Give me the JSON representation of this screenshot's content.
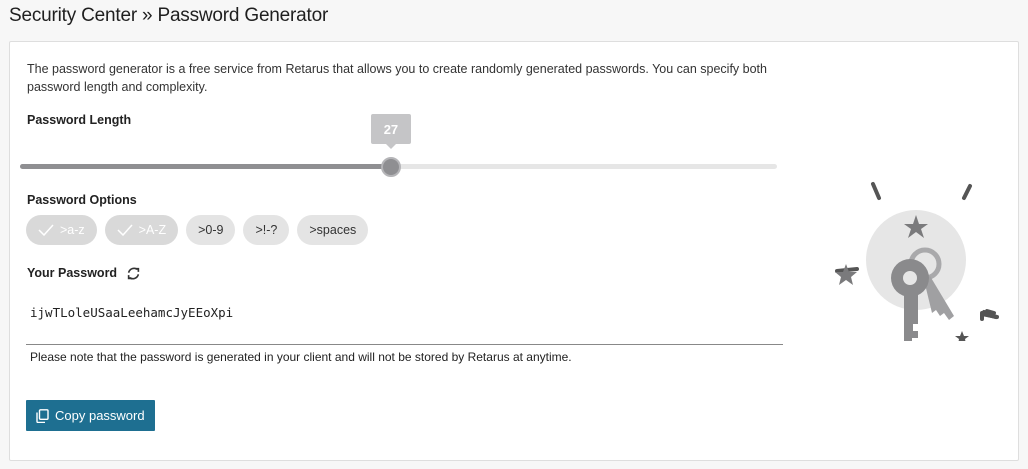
{
  "page": {
    "title": "Security Center » Password Generator"
  },
  "intro": {
    "text": "The password generator is a free service from Retarus that allows you to create randomly generated passwords. You can specify both password length and complexity."
  },
  "length": {
    "label": "Password Length",
    "value": "27",
    "fraction": 0.49
  },
  "options": {
    "label": "Password Options",
    "items": [
      {
        "label": ">a-z",
        "active": true
      },
      {
        "label": ">A-Z",
        "active": true
      },
      {
        "label": ">0-9",
        "active": false
      },
      {
        "label": ">!-?",
        "active": false
      },
      {
        "label": ">spaces",
        "active": false
      }
    ]
  },
  "password": {
    "label": "Your Password",
    "value": "ijwTLoleUSaaLeehamcJyEEoXpi",
    "note": "Please note that the password is generated in your client and will not be stored by Retarus at anytime."
  },
  "actions": {
    "copy_label": "Copy password"
  },
  "icons": {
    "refresh": "refresh-icon",
    "copy": "copy-icon",
    "check": "check-icon",
    "illustration": "keys-illustration"
  },
  "colors": {
    "accent": "#1e6f91",
    "slider": "#8f8f92",
    "chip": "#e4e4e4"
  }
}
